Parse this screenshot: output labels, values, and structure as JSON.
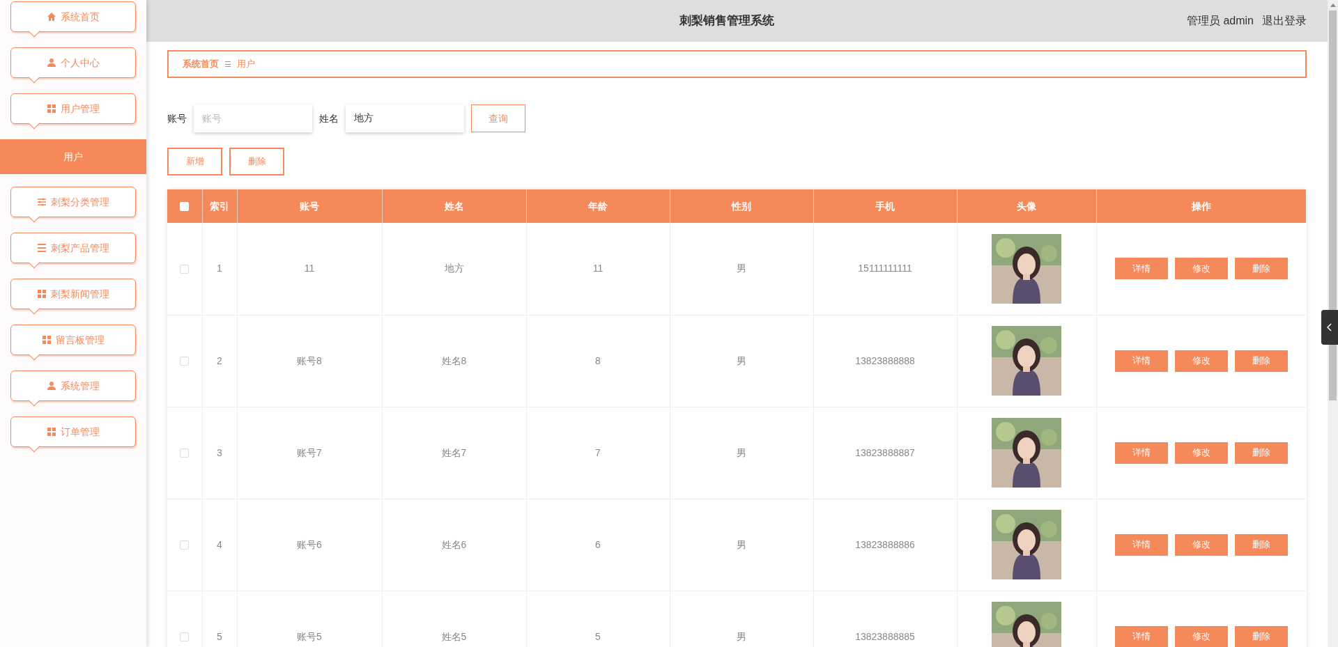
{
  "sidebar": {
    "items": [
      {
        "label": "系统首页",
        "selected": false
      },
      {
        "label": "个人中心",
        "selected": false
      },
      {
        "label": "用户管理",
        "selected": false
      },
      {
        "label": "用户",
        "selected": true
      },
      {
        "label": "刺梨分类管理",
        "selected": false
      },
      {
        "label": "刺梨产品管理",
        "selected": false
      },
      {
        "label": "刺梨新闻管理",
        "selected": false
      },
      {
        "label": "留言板管理",
        "selected": false
      },
      {
        "label": "系统管理",
        "selected": false
      },
      {
        "label": "订单管理",
        "selected": false
      }
    ]
  },
  "header": {
    "title": "刺梨销售管理系统",
    "user": "管理员 admin",
    "logout": "退出登录"
  },
  "breadcrumb": {
    "home": "系统首页",
    "separator": "☰",
    "current": "用户"
  },
  "search": {
    "fields": [
      {
        "label": "账号",
        "placeholder": "账号"
      },
      {
        "label": "姓名",
        "value": "地方"
      }
    ],
    "button": "查询"
  },
  "actions": [
    "新增",
    "删除"
  ],
  "table": {
    "select_all_checked": false,
    "columns": [
      "索引",
      "账号",
      "姓名",
      "年龄",
      "性别",
      "手机",
      "头像",
      "操作"
    ],
    "rows": [
      {
        "checked": false,
        "cells": [
          "1",
          "11",
          "地方",
          "11",
          "男",
          "15111111111"
        ],
        "buttons": [
          "详情",
          "修改",
          "删除"
        ]
      },
      {
        "checked": false,
        "cells": [
          "2",
          "账号8",
          "姓名8",
          "8",
          "男",
          "13823888888"
        ],
        "buttons": [
          "详情",
          "修改",
          "删除"
        ]
      },
      {
        "checked": false,
        "cells": [
          "3",
          "账号7",
          "姓名7",
          "7",
          "男",
          "13823888887"
        ],
        "buttons": [
          "详情",
          "修改",
          "删除"
        ]
      },
      {
        "checked": false,
        "cells": [
          "4",
          "账号6",
          "姓名6",
          "6",
          "男",
          "13823888886"
        ],
        "buttons": [
          "详情",
          "修改",
          "删除"
        ]
      },
      {
        "checked": false,
        "cells": [
          "5",
          "账号5",
          "姓名5",
          "5",
          "男",
          "13823888885"
        ],
        "buttons": [
          "详情",
          "修改",
          "删除"
        ]
      }
    ]
  }
}
